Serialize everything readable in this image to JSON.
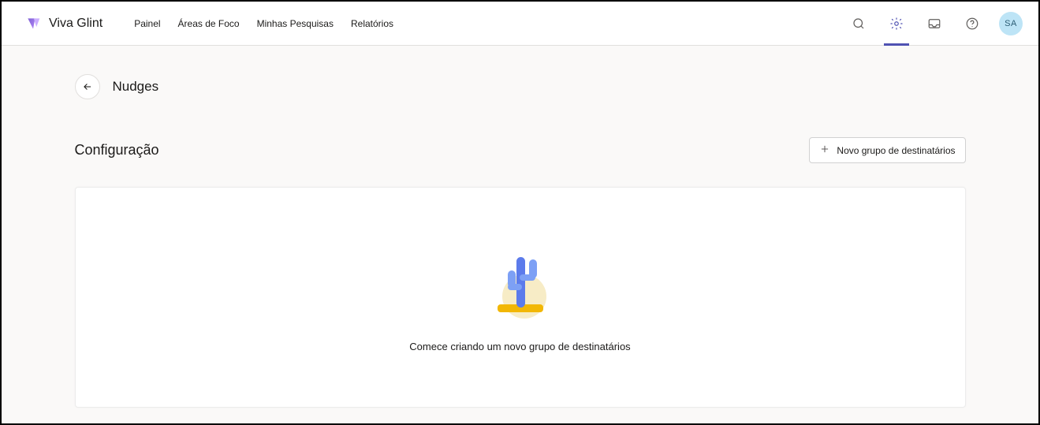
{
  "brand": {
    "name": "Viva Glint"
  },
  "nav": {
    "items": [
      {
        "label": "Painel"
      },
      {
        "label": "Áreas de Foco"
      },
      {
        "label": "Minhas Pesquisas"
      },
      {
        "label": "Relatórios"
      }
    ]
  },
  "user": {
    "initials": "SA"
  },
  "page": {
    "title": "Nudges",
    "section_title": "Configuração",
    "new_group_label": "Novo grupo de destinatários",
    "empty_message": "Comece criando um novo grupo de destinatários"
  }
}
